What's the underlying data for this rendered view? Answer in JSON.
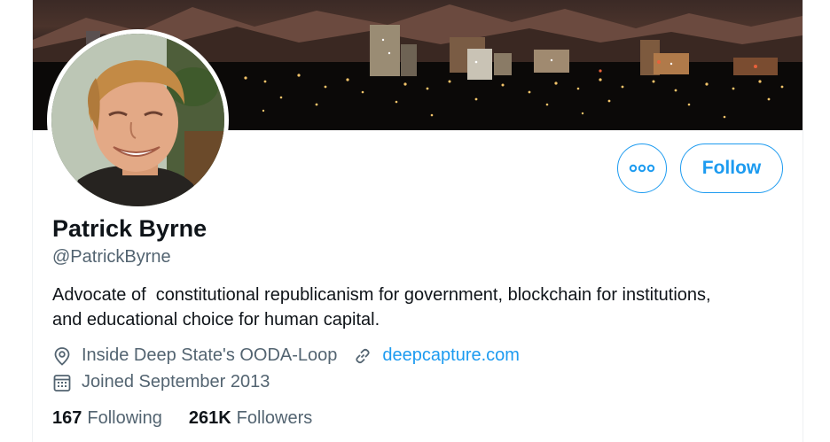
{
  "profile": {
    "name": "Patrick Byrne",
    "handle": "@PatrickByrne",
    "bio": "Advocate of  constitutional republicanism for government, blockchain for institutions, and educational choice for human capital.",
    "location": "Inside Deep State's OODA-Loop",
    "website": "deepcapture.com",
    "joined": "Joined September 2013"
  },
  "actions": {
    "follow_label": "Follow",
    "more_icon": "more-horizontal-icon"
  },
  "stats": {
    "following_count": "167",
    "following_label": "Following",
    "followers_count": "261K",
    "followers_label": "Followers"
  },
  "colors": {
    "accent": "#1d9bf0",
    "secondary_text": "#536471",
    "primary_text": "#0f1419"
  }
}
